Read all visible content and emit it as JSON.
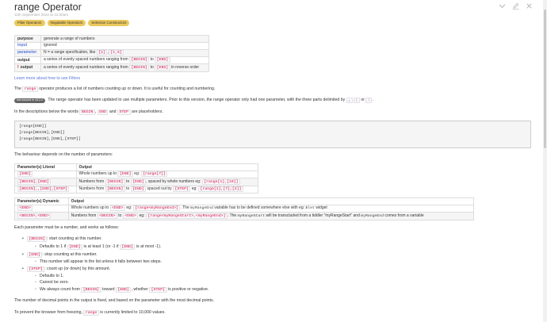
{
  "header": {
    "title": "range Operator",
    "subtitle": "11th September 2023 at 12:20am",
    "tags": [
      "Filter Operators",
      "Negatable Operators",
      "Selection Constructors"
    ]
  },
  "info_table": {
    "purpose_label": "purpose",
    "purpose_value": "generate a range of numbers",
    "input_label": "input",
    "input_value": "ignored",
    "parameter_label": "parameter",
    "parameter_value": "N = a range specification, like",
    "parameter_code1": "[1]",
    "parameter_sep": ",",
    "parameter_code2": "[1,5]",
    "output_label": "output",
    "output_value": "a series of evenly spaced numbers ranging from",
    "output_code1": "[BEGIN]",
    "output_to": "to",
    "output_code2": "[END]",
    "neg_bang": "!",
    "neg_label": "output",
    "neg_value": "a series of evenly spaced numbers ranging from",
    "neg_code1": "[BEGIN]",
    "neg_to": "to",
    "neg_code2": "[END]",
    "neg_suffix": "in reverse order"
  },
  "learn_more": "Learn more about how to use Filters",
  "intro": {
    "pre": "The",
    "code": "range",
    "post": "operator produces a list of numbers counting up or down. It is useful for counting and numbering."
  },
  "version_note": {
    "badge": "Introduced in v5.2.0",
    "text": "The range operator has been updated to use multiple parameters. Prior to this version, the range operator only had one parameter, with the three parts delimited by",
    "code1": ",",
    "code2": ";",
    "or": "or",
    "code3": ":",
    "end": "."
  },
  "desc": {
    "pre": "In the descriptions below the words",
    "c1": "BEGIN",
    "sep": ",",
    "c2": "END",
    "and": "and",
    "c3": "STEP",
    "post": "are placeholders."
  },
  "codeblock": [
    "[range[END]]",
    "[range[BEGIN],[END]]",
    "[range[BEGIN],[END],[STEP]]"
  ],
  "behaviour": "The behaviour depends on the number of parameters:",
  "table1": {
    "h1": "Parameter(s) Literal",
    "h2": "Output",
    "rows": [
      {
        "p": "[END]",
        "a": "Whole numbers up to",
        "c": "[END]",
        "b": "eg:",
        "e": "[range[7]]",
        "m": "",
        "f": ""
      },
      {
        "p": "[BEGIN],[END]",
        "a": "Numbers from",
        "c": "[BEGIN]",
        "b": "to",
        "e": "[END]",
        "m": ", spaced by whole numbers eg:",
        "f": "[range[1],[10]]"
      },
      {
        "p": "[BEGIN],,[END],[STEP]",
        "a": "Numbers from",
        "c": "[BEGIN]",
        "b": "to",
        "e": "[END]",
        "m": "spaced out by",
        "f": "[STEP]"
      }
    ],
    "r3_eg": "eg:",
    "r3_code": "[range[1],[7],[2]]"
  },
  "table2": {
    "h1": "Parameter(s) Dynamic",
    "h2": "Output",
    "r1_p": "<END>",
    "r1_a": "Whole numbers up to",
    "r1_c": "<END>",
    "r1_b": "eg:",
    "r1_e": "[range<myRangeEnd>]",
    "r1_m": ". The",
    "r1_var": "myRangeEnd",
    "r1_tail": "variable has to be defined somewhere else with eg:",
    "r1_let": "$let",
    "r1_end": "widget",
    "r2_p": "<BEGIN>,<END>",
    "r2_a": "Numbers from",
    "r2_c1": "<BEGIN>",
    "r2_to": "to",
    "r2_c2": "<END>",
    "r2_eg": "eg:",
    "r2_e": "[range<myRangeStart>,<myRangeEnd>]",
    "r2_m": ". The",
    "r2_var": "myRangeStart",
    "r2_tail": "will be transcluded from a tiddler \"myRangeStart\" and",
    "r2_var2": "myRangeEnd",
    "r2_end": "comes from a variable"
  },
  "each_param": "Each parameter must be a number, and works as follows:",
  "list": {
    "i1_code": "[BEGIN]",
    "i1_text": ": start counting at this number.",
    "i1a_pre": "Defaults to 1 if",
    "i1a_c1": "[END]",
    "i1a_mid": "is at least 1 (or -1 if",
    "i1a_c2": "[END]",
    "i1a_post": "is at most -1).",
    "i2_code": "[END]",
    "i2_text": ": stop counting at this number.",
    "i2a": "This number will appear in the list unless it falls between two steps.",
    "i3_code": "[STEP]",
    "i3_text": ": count up (or down) by this amount.",
    "i3a": "Defaults to 1.",
    "i3b": "Cannot be zero.",
    "i3c_pre": "We always count from",
    "i3c_c1": "[BEGIN]",
    "i3c_mid": "toward",
    "i3c_c2": "[END]",
    "i3c_mid2": ", whether",
    "i3c_c3": "[STEP]",
    "i3c_post": "is positive or negative."
  },
  "decimal": "The number of decimal points in the output is fixed, and based on the parameter with the most decimal points.",
  "freeze": {
    "pre": "To prevent the browser from freezing,",
    "code": "range",
    "post": "is currently limited to 10,000 values."
  }
}
